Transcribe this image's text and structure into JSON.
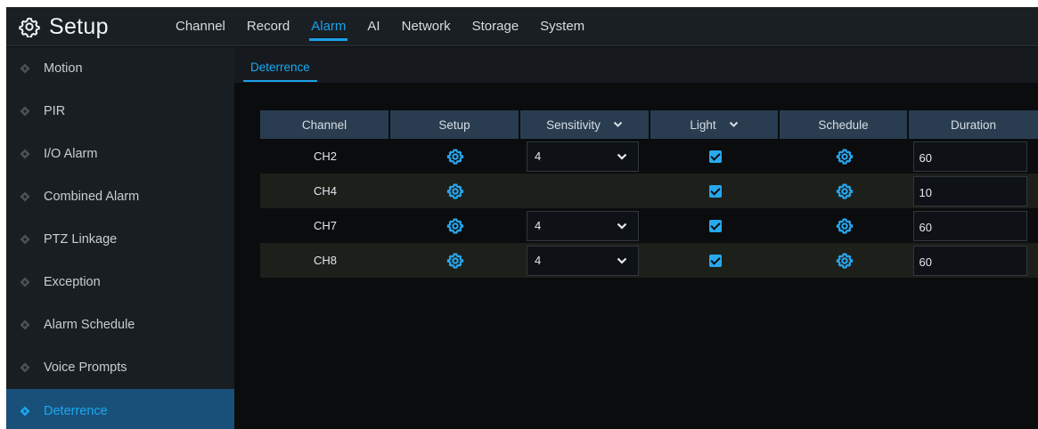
{
  "app": {
    "title": "Setup",
    "nav": [
      "Channel",
      "Record",
      "Alarm",
      "AI",
      "Network",
      "Storage",
      "System"
    ],
    "active_nav": "Alarm"
  },
  "sidebar": {
    "items": [
      {
        "label": "Motion"
      },
      {
        "label": "PIR"
      },
      {
        "label": "I/O Alarm"
      },
      {
        "label": "Combined Alarm"
      },
      {
        "label": "PTZ Linkage"
      },
      {
        "label": "Exception"
      },
      {
        "label": "Alarm Schedule"
      },
      {
        "label": "Voice Prompts"
      },
      {
        "label": "Deterrence"
      }
    ],
    "active": "Deterrence"
  },
  "subtab": {
    "label": "Deterrence"
  },
  "table": {
    "headers": {
      "channel": "Channel",
      "setup": "Setup",
      "sensitivity": "Sensitivity",
      "light": "Light",
      "schedule": "Schedule",
      "duration": "Duration"
    },
    "rows": [
      {
        "channel": "CH2",
        "sensitivity": "4",
        "light": true,
        "duration": "60"
      },
      {
        "channel": "CH4",
        "sensitivity": "",
        "light": true,
        "duration": "10"
      },
      {
        "channel": "CH7",
        "sensitivity": "4",
        "light": true,
        "duration": "60"
      },
      {
        "channel": "CH8",
        "sensitivity": "4",
        "light": true,
        "duration": "60"
      }
    ]
  },
  "colors": {
    "accent": "#1ba0e8",
    "header_bg": "#2a3d50",
    "sidebar_bg": "#191e23",
    "sidebar_active_bg": "#19507a",
    "content_bg": "#0a0c0e"
  },
  "icons": {
    "brand": "gear-icon",
    "setup": "gear-icon",
    "schedule": "gear-icon",
    "dropdown": "chevron-down-icon",
    "sidebar_bullet": "diamond-icon"
  }
}
